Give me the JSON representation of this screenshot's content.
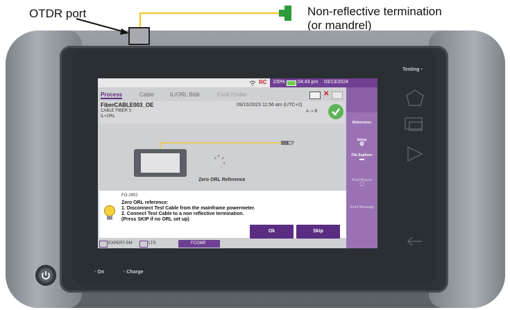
{
  "callouts": {
    "otdr_port": "OTDR port",
    "termination_line1": "Non-reflective termination",
    "termination_line2": "(or mandrel)"
  },
  "device": {
    "testing_label": "Testing",
    "on_label": "On",
    "charge_label": "Charge"
  },
  "status": {
    "battery": "100%",
    "time": "04:43 pm",
    "date": "03/13/2024"
  },
  "tabs": [
    {
      "label": "Process",
      "active": true
    },
    {
      "label": "Cable",
      "active": false
    },
    {
      "label": "IL/ORL Bidir",
      "active": false
    },
    {
      "label": "Fault Finder",
      "active": false
    }
  ],
  "info": {
    "title": "FiberCABLE003_OE",
    "subtitle1": "CABLE FIBER 3",
    "subtitle2": "IL+ORL",
    "datetime": "09/15/2023 11:56 am (UTC+2)",
    "direction": "A -> B"
  },
  "diagram": {
    "zero_orl_label": "Zero ORL Reference"
  },
  "dialog": {
    "code": "FO-2902",
    "line1": "Zero ORL reference:",
    "line2": "1. Disconnect Test Cable from the mainframe powermeter.",
    "line3": "2. Connect Test Cable to a non reflective termination.",
    "line4": "(Press SKIP if no ORL set up)",
    "ok_label": "Ok",
    "skip_label": "Skip"
  },
  "sidebar": {
    "items": [
      {
        "label": "References",
        "enabled": true
      },
      {
        "label": "Setup",
        "enabled": true
      },
      {
        "label": "File Explorer",
        "enabled": true
      },
      {
        "label": "Post Report",
        "enabled": false
      },
      {
        "label": "Send Message",
        "enabled": false
      }
    ]
  },
  "bottombar": {
    "item1": "EXPERT-SM",
    "item2": "LTS",
    "item3": "FCOMP"
  },
  "colors": {
    "accent": "#5a2d82",
    "sidebar": "#9a72b3",
    "fiber": "#f2c21a",
    "termination": "#2e9b3a",
    "check": "#5fb35a"
  }
}
